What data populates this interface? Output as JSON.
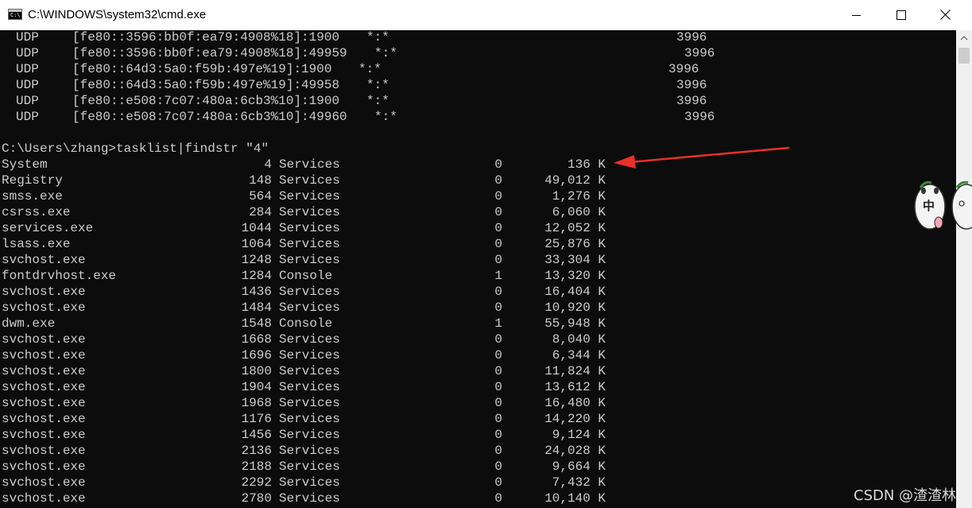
{
  "window": {
    "title": "C:\\WINDOWS\\system32\\cmd.exe",
    "icon_text": "C:\\",
    "icons": {
      "app": "cmd-icon",
      "minimize": "minimize-icon",
      "maximize": "maximize-icon",
      "close": "close-icon"
    }
  },
  "netstat_rows": [
    {
      "proto": "UDP",
      "address": "[fe80::3596:bb0f:ea79:4908%18]:1900",
      "remote": "*:*",
      "pid": "3996"
    },
    {
      "proto": "UDP",
      "address": "[fe80::3596:bb0f:ea79:4908%18]:49959",
      "remote": "*:*",
      "pid": "3996"
    },
    {
      "proto": "UDP",
      "address": "[fe80::64d3:5a0:f59b:497e%19]:1900",
      "remote": "*:*",
      "pid": "3996"
    },
    {
      "proto": "UDP",
      "address": "[fe80::64d3:5a0:f59b:497e%19]:49958",
      "remote": "*:*",
      "pid": "3996"
    },
    {
      "proto": "UDP",
      "address": "[fe80::e508:7c07:480a:6cb3%10]:1900",
      "remote": "*:*",
      "pid": "3996"
    },
    {
      "proto": "UDP",
      "address": "[fe80::e508:7c07:480a:6cb3%10]:49960",
      "remote": "*:*",
      "pid": "3996"
    }
  ],
  "prompt": "C:\\Users\\zhang>tasklist|findstr \"4\"",
  "tasklist_rows": [
    {
      "name": "System",
      "pid": "4",
      "session": "Services",
      "session_num": "0",
      "mem": "136 K"
    },
    {
      "name": "Registry",
      "pid": "148",
      "session": "Services",
      "session_num": "0",
      "mem": "49,012 K"
    },
    {
      "name": "smss.exe",
      "pid": "564",
      "session": "Services",
      "session_num": "0",
      "mem": "1,276 K"
    },
    {
      "name": "csrss.exe",
      "pid": "284",
      "session": "Services",
      "session_num": "0",
      "mem": "6,060 K"
    },
    {
      "name": "services.exe",
      "pid": "1044",
      "session": "Services",
      "session_num": "0",
      "mem": "12,052 K"
    },
    {
      "name": "lsass.exe",
      "pid": "1064",
      "session": "Services",
      "session_num": "0",
      "mem": "25,876 K"
    },
    {
      "name": "svchost.exe",
      "pid": "1248",
      "session": "Services",
      "session_num": "0",
      "mem": "33,304 K"
    },
    {
      "name": "fontdrvhost.exe",
      "pid": "1284",
      "session": "Console",
      "session_num": "1",
      "mem": "13,320 K"
    },
    {
      "name": "svchost.exe",
      "pid": "1436",
      "session": "Services",
      "session_num": "0",
      "mem": "16,404 K"
    },
    {
      "name": "svchost.exe",
      "pid": "1484",
      "session": "Services",
      "session_num": "0",
      "mem": "10,920 K"
    },
    {
      "name": "dwm.exe",
      "pid": "1548",
      "session": "Console",
      "session_num": "1",
      "mem": "55,948 K"
    },
    {
      "name": "svchost.exe",
      "pid": "1668",
      "session": "Services",
      "session_num": "0",
      "mem": "8,040 K"
    },
    {
      "name": "svchost.exe",
      "pid": "1696",
      "session": "Services",
      "session_num": "0",
      "mem": "6,344 K"
    },
    {
      "name": "svchost.exe",
      "pid": "1800",
      "session": "Services",
      "session_num": "0",
      "mem": "11,824 K"
    },
    {
      "name": "svchost.exe",
      "pid": "1904",
      "session": "Services",
      "session_num": "0",
      "mem": "13,612 K"
    },
    {
      "name": "svchost.exe",
      "pid": "1968",
      "session": "Services",
      "session_num": "0",
      "mem": "16,480 K"
    },
    {
      "name": "svchost.exe",
      "pid": "1176",
      "session": "Services",
      "session_num": "0",
      "mem": "14,220 K"
    },
    {
      "name": "svchost.exe",
      "pid": "1456",
      "session": "Services",
      "session_num": "0",
      "mem": "9,124 K"
    },
    {
      "name": "svchost.exe",
      "pid": "2136",
      "session": "Services",
      "session_num": "0",
      "mem": "24,028 K"
    },
    {
      "name": "svchost.exe",
      "pid": "2188",
      "session": "Services",
      "session_num": "0",
      "mem": "9,664 K"
    },
    {
      "name": "svchost.exe",
      "pid": "2292",
      "session": "Services",
      "session_num": "0",
      "mem": "7,432 K"
    },
    {
      "name": "svchost.exe",
      "pid": "2780",
      "session": "Services",
      "session_num": "0",
      "mem": "10,140 K"
    }
  ],
  "ime": {
    "label": "中"
  },
  "watermark": "CSDN @渣渣林",
  "colors": {
    "console_bg": "#0c0c0c",
    "console_fg": "#cccccc",
    "arrow": "#e8302a",
    "titlebar": "#ffffff"
  },
  "annotation": {
    "type": "red-arrow-icon",
    "points_to": "136 K"
  }
}
